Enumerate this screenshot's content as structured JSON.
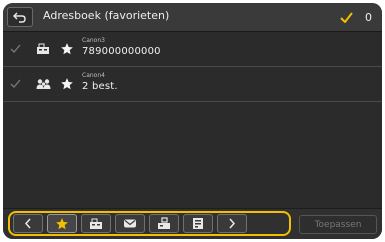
{
  "header": {
    "title": "Adresboek (favorieten)",
    "selected_count": "0"
  },
  "entries": [
    {
      "name": "Canon3",
      "value": "789000000000",
      "type_icon": "fax-icon",
      "favorite": true
    },
    {
      "name": "Canon4",
      "value": "2 best.",
      "type_icon": "group-icon",
      "favorite": true
    }
  ],
  "toolbar": {
    "buttons": [
      "chevron-left-icon",
      "star-icon",
      "fax-icon",
      "email-icon",
      "file-server-icon",
      "ifax-icon",
      "chevron-right-icon"
    ],
    "active": "star-icon"
  },
  "apply_label": "Toepassen",
  "colors": {
    "accent": "#f2c000",
    "background": "#2b2b2b",
    "text": "#eeeeee"
  }
}
